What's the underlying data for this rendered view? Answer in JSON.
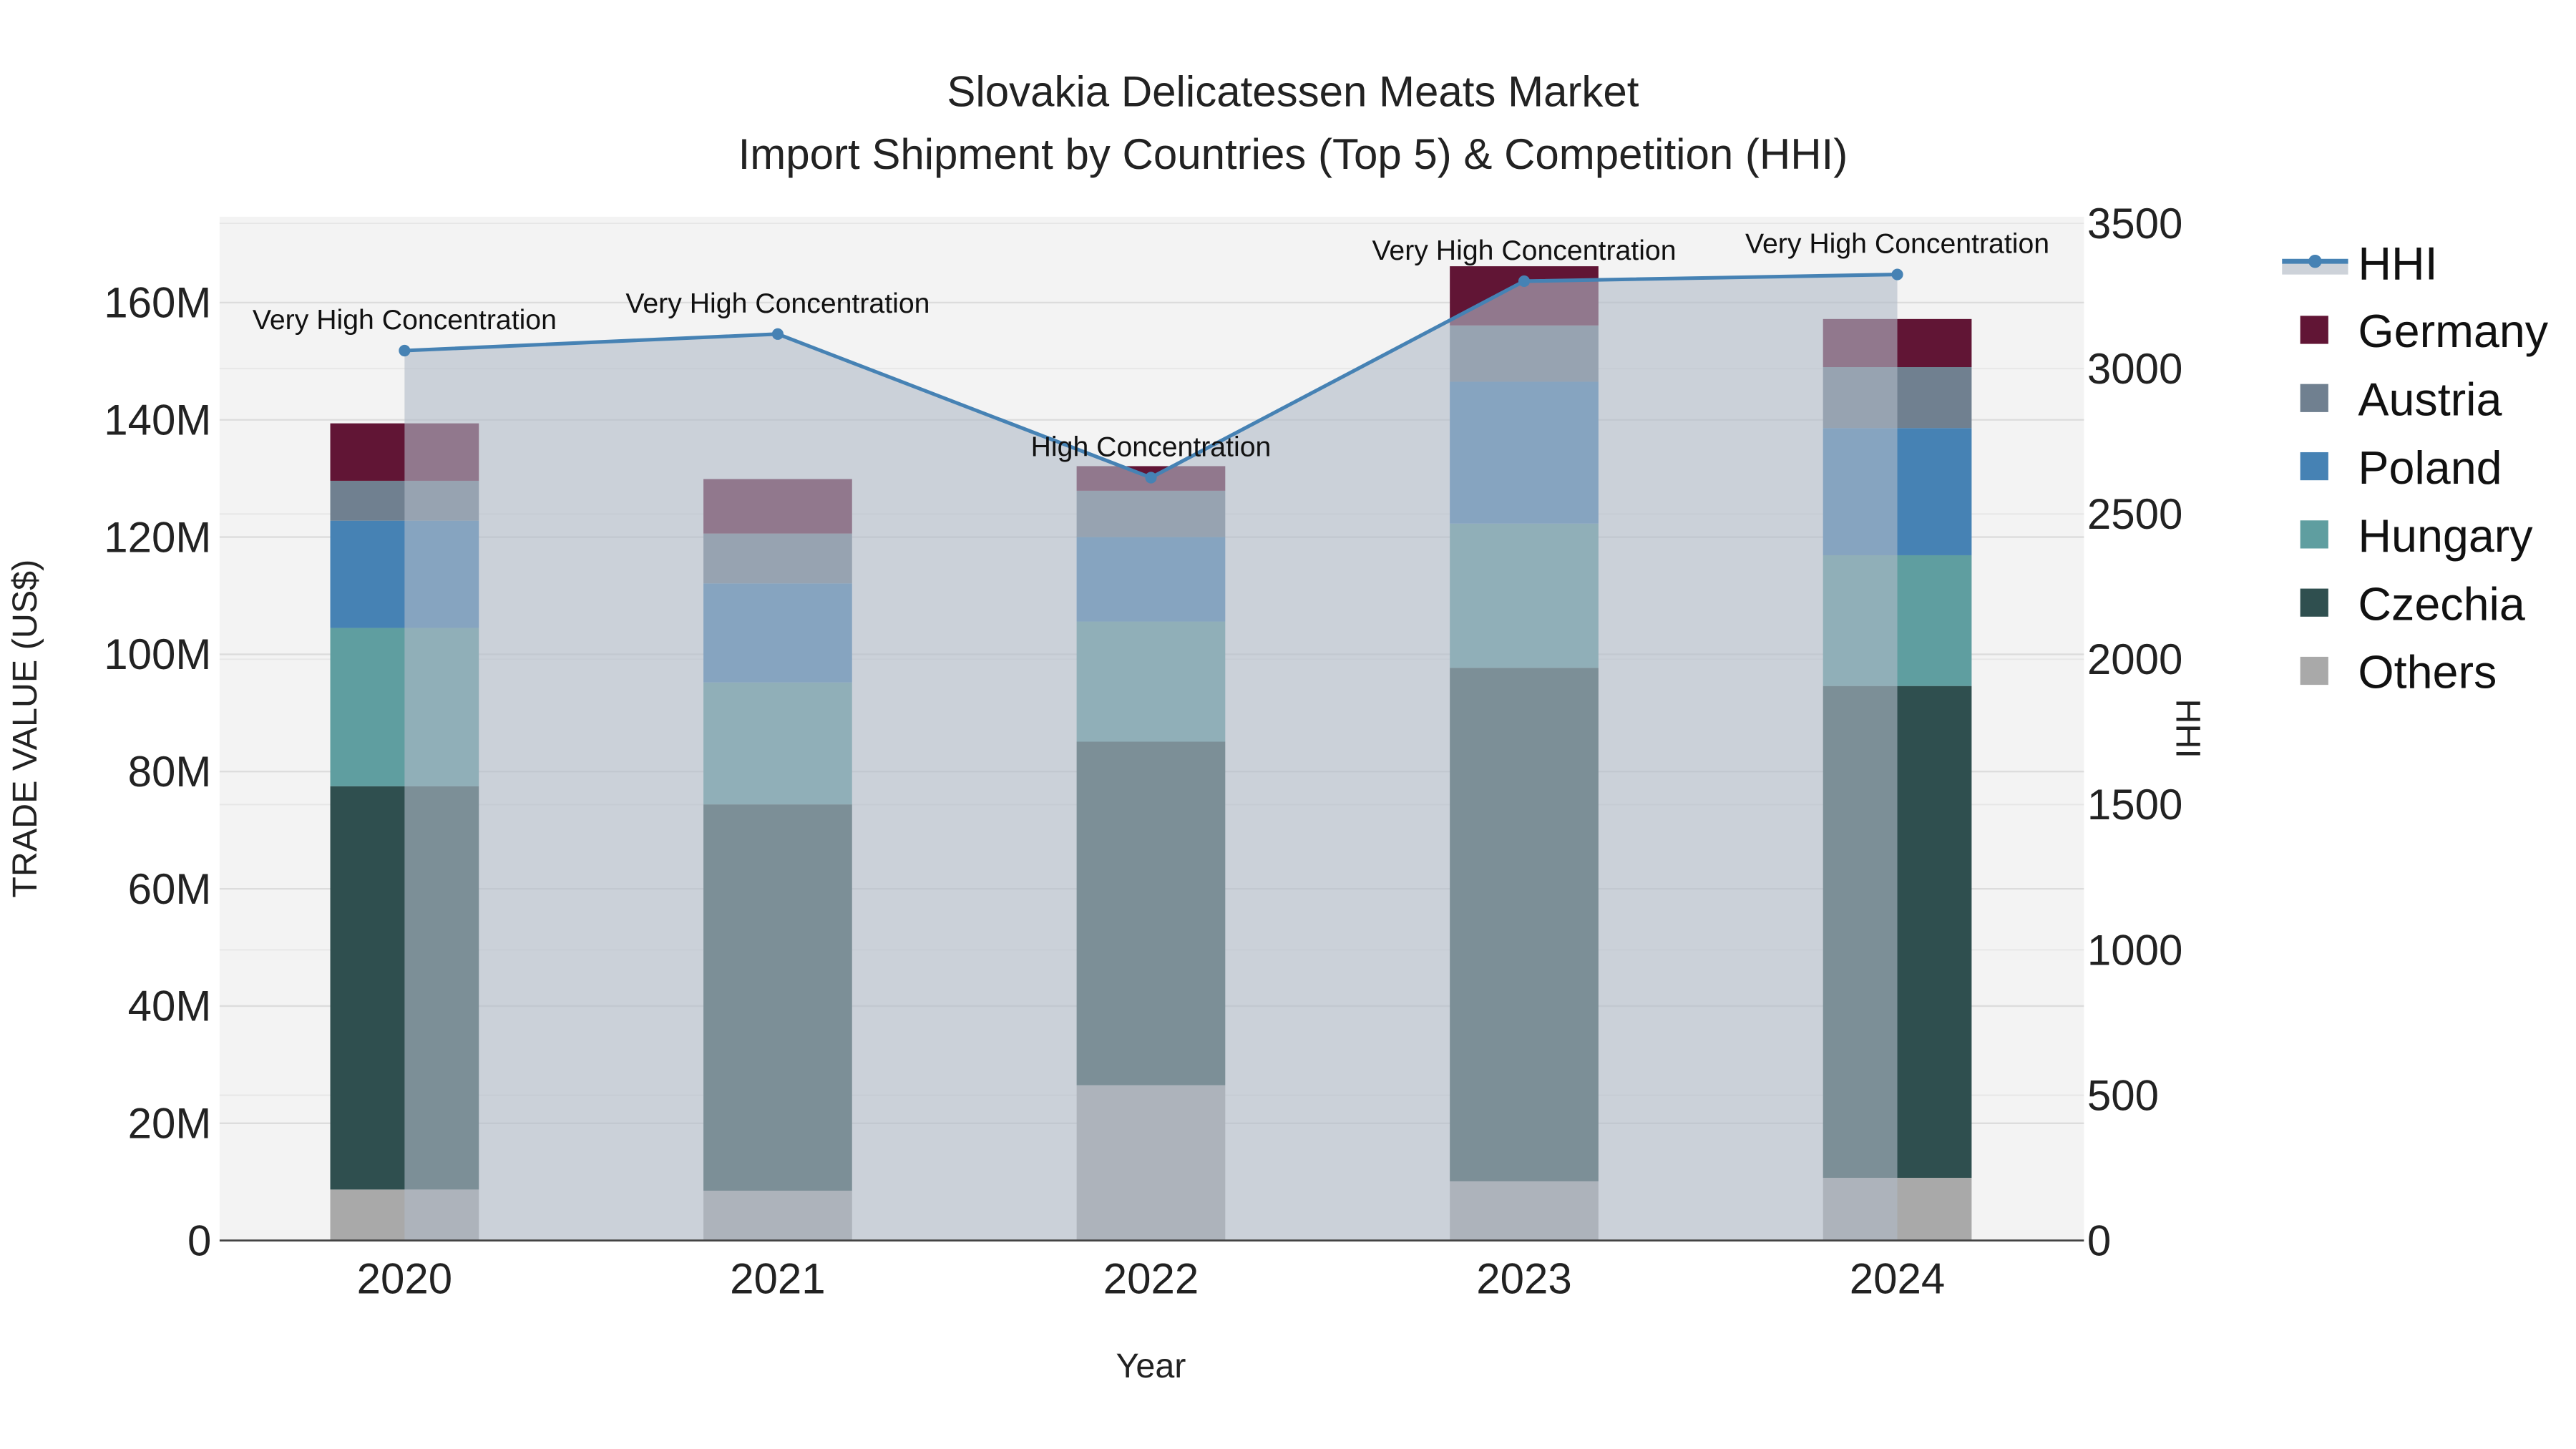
{
  "chart_data": {
    "type": "bar",
    "title": "Slovakia Delicatessen Meats Market",
    "subtitle": "Import Shipment by Countries (Top 5) & Competition (HHI)",
    "xlabel": "Year",
    "ylabel": "TRADE VALUE (US$)",
    "y2label": "HHI",
    "categories": [
      "2020",
      "2021",
      "2022",
      "2023",
      "2024"
    ],
    "ylim": [
      0,
      170000000
    ],
    "y2lim": [
      0,
      3500
    ],
    "yticks": [
      0,
      20000000,
      40000000,
      60000000,
      80000000,
      100000000,
      120000000,
      140000000,
      160000000
    ],
    "ytick_labels": [
      "0",
      "20M",
      "40M",
      "60M",
      "80M",
      "100M",
      "120M",
      "140M",
      "160M"
    ],
    "y2ticks": [
      0,
      500,
      1000,
      1500,
      2000,
      2500,
      3000,
      3500
    ],
    "y2tick_labels": [
      "0",
      "500",
      "1000",
      "1500",
      "2000",
      "2500",
      "3000",
      "3500"
    ],
    "grid": true,
    "legend_position": "right",
    "series": [
      {
        "name": "Others",
        "color": "#a9a9a9",
        "values": [
          8700000,
          8500000,
          26500000,
          10100000,
          10700000
        ]
      },
      {
        "name": "Czechia",
        "color": "#2f4f4f",
        "values": [
          68800000,
          65900000,
          58600000,
          87600000,
          83900000
        ]
      },
      {
        "name": "Hungary",
        "color": "#5f9ea0",
        "values": [
          27000000,
          20800000,
          20500000,
          24600000,
          22300000
        ]
      },
      {
        "name": "Poland",
        "color": "#4682b4",
        "values": [
          18300000,
          16900000,
          14400000,
          24200000,
          21700000
        ]
      },
      {
        "name": "Austria",
        "color": "#708090",
        "values": [
          6800000,
          8500000,
          7900000,
          9600000,
          10400000
        ]
      },
      {
        "name": "Germany",
        "color": "#611535",
        "values": [
          9800000,
          9300000,
          4200000,
          10100000,
          8200000
        ]
      }
    ],
    "hhi": {
      "name": "HHI",
      "color": "#4682b4",
      "values": [
        3062,
        3119,
        2625,
        3301,
        3324
      ],
      "annotations": [
        "Very High Concentration",
        "Very High Concentration",
        "High Concentration",
        "Very High Concentration",
        "Very High Concentration"
      ]
    }
  }
}
